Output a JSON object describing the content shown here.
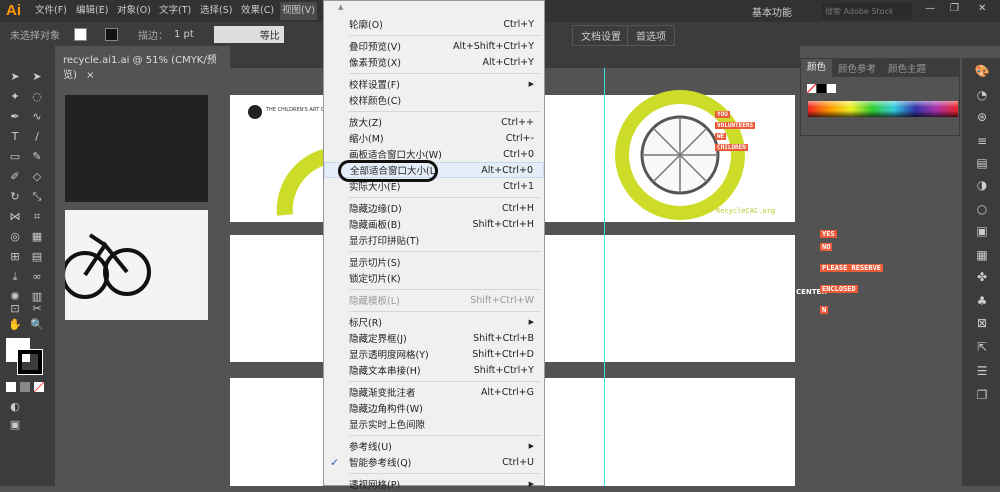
{
  "app": {
    "logo": "Ai",
    "menus": [
      "文件(F)",
      "编辑(E)",
      "对象(O)",
      "文字(T)",
      "选择(S)",
      "效果(C)",
      "视图(V)"
    ],
    "workspace": "基本功能",
    "search_placeholder": "搜索 Adobe Stock"
  },
  "control": {
    "selection": "未选择对象",
    "stroke_label": "描边：",
    "stroke_value": "1 pt",
    "profile": "等比",
    "doc_setup": "文档设置",
    "prefs": "首选项"
  },
  "tab": {
    "title": "recycle.ai1.ai @ 51% (CMYK/预览)",
    "close": "×"
  },
  "panel": {
    "tabs": [
      "颜色",
      "颜色参考",
      "颜色主题"
    ]
  },
  "artwork": {
    "header": "THE CHILDREN'S ART CENTER",
    "tags": [
      "YOU",
      "VOLUNTEERS",
      "WE",
      "CHILDREN"
    ],
    "url": "RecycleCAC.org",
    "center": "CENTER",
    "form": [
      "YES",
      "NO",
      "PLEASE RESERVE",
      "ENCLOSED",
      "N"
    ]
  },
  "menu": [
    {
      "label": "轮廓(O)",
      "sc": "Ctrl+Y"
    },
    {
      "sep": true
    },
    {
      "label": "叠印预览(V)",
      "sc": "Alt+Shift+Ctrl+Y"
    },
    {
      "label": "像素预览(X)",
      "sc": "Alt+Ctrl+Y"
    },
    {
      "sep": true
    },
    {
      "label": "校样设置(F)",
      "sub": true
    },
    {
      "label": "校样颜色(C)"
    },
    {
      "sep": true
    },
    {
      "label": "放大(Z)",
      "sc": "Ctrl++"
    },
    {
      "label": "缩小(M)",
      "sc": "Ctrl+-"
    },
    {
      "label": "画板适合窗口大小(W)",
      "sc": "Ctrl+0"
    },
    {
      "label": "全部适合窗口大小(L)",
      "sc": "Alt+Ctrl+0",
      "hl": true
    },
    {
      "label": "实际大小(E)",
      "sc": "Ctrl+1"
    },
    {
      "sep": true
    },
    {
      "label": "隐藏边缘(D)",
      "sc": "Ctrl+H"
    },
    {
      "label": "隐藏画板(B)",
      "sc": "Shift+Ctrl+H"
    },
    {
      "label": "显示打印拼贴(T)"
    },
    {
      "sep": true
    },
    {
      "label": "显示切片(S)"
    },
    {
      "label": "锁定切片(K)"
    },
    {
      "sep": true
    },
    {
      "label": "隐藏模板(L)",
      "sc": "Shift+Ctrl+W",
      "dis": true
    },
    {
      "sep": true
    },
    {
      "label": "标尺(R)",
      "sub": true
    },
    {
      "label": "隐藏定界框(J)",
      "sc": "Shift+Ctrl+B"
    },
    {
      "label": "显示透明度网格(Y)",
      "sc": "Shift+Ctrl+D"
    },
    {
      "label": "隐藏文本串接(H)",
      "sc": "Shift+Ctrl+Y"
    },
    {
      "sep": true
    },
    {
      "label": "隐藏渐变批注者",
      "sc": "Alt+Ctrl+G"
    },
    {
      "label": "隐藏边角构件(W)"
    },
    {
      "label": "显示实时上色间隙"
    },
    {
      "sep": true
    },
    {
      "label": "参考线(U)",
      "sub": true
    },
    {
      "label": "智能参考线(Q)",
      "sc": "Ctrl+U",
      "checked": true
    },
    {
      "sep": true
    },
    {
      "label": "透视网格(P)",
      "sub": true
    }
  ]
}
